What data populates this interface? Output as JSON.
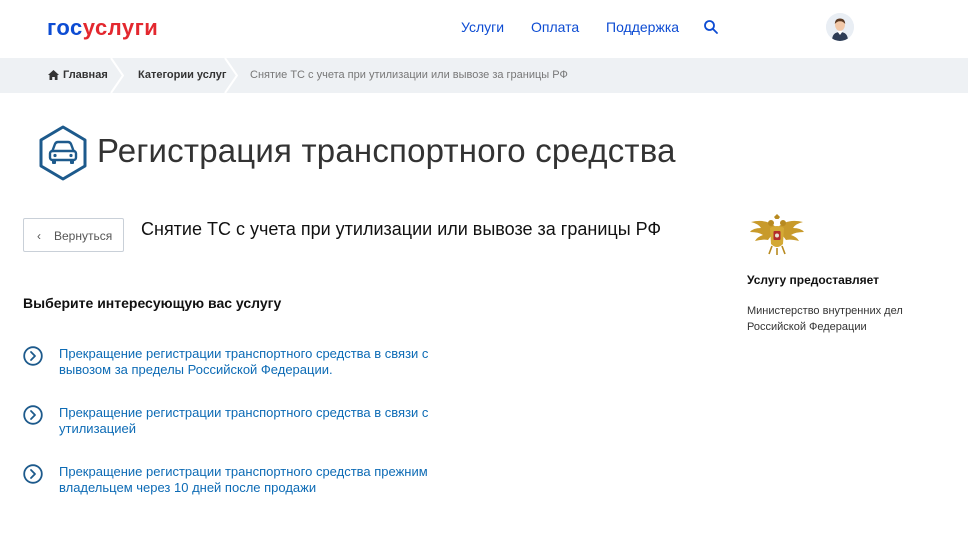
{
  "header": {
    "logo_part1": "гос",
    "logo_part2": "услуги",
    "nav": [
      "Услуги",
      "Оплата",
      "Поддержка"
    ]
  },
  "breadcrumbs": [
    "Главная",
    "Категории услуг",
    "Снятие ТС с учета при утилизации или вывозе за границы РФ"
  ],
  "page": {
    "title": "Регистрация транспортного средства",
    "back_label": "Вернуться",
    "service_title": "Снятие ТС с учета при утилизации или вывозе за границы РФ",
    "section_title": "Выберите интересующую вас услугу",
    "options": [
      "Прекращение регистрации транспортного средства в связи с вывозом за пределы Российской Федерации.",
      "Прекращение регистрации транспортного средства в связи с утилизацией",
      "Прекращение регистрации транспортного средства прежним владельцем через 10 дней после продажи"
    ]
  },
  "provider": {
    "label": "Услугу предоставляет",
    "name": "Министерство внутренних дел Российской Федерации"
  },
  "icons": {
    "search": "search-icon",
    "home": "home-icon",
    "car": "car-icon",
    "arrow": "arrow-right-circle-icon",
    "emblem": "double-headed-eagle-emblem"
  },
  "colors": {
    "brand_blue": "#0d4cd3",
    "brand_red": "#e3282f",
    "link": "#0d6bb5",
    "icon_blue": "#1d5a8c",
    "breadcrumb_bg": "#eef1f4"
  }
}
